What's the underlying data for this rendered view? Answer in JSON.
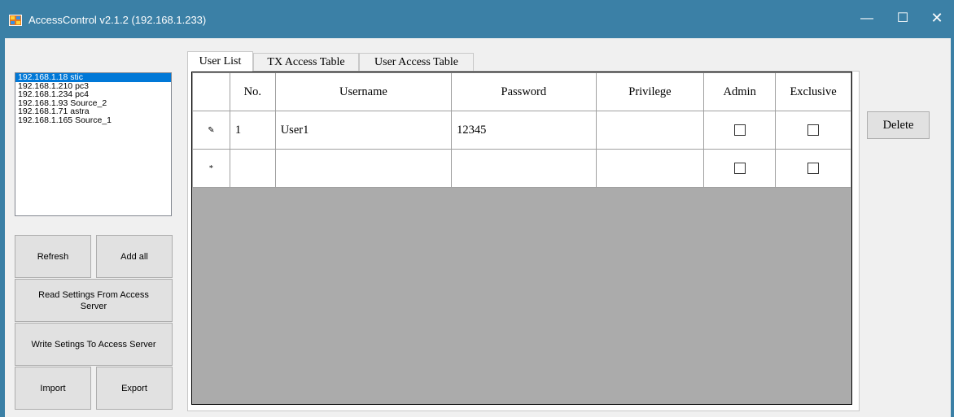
{
  "window": {
    "title": "AccessControl v2.1.2 (192.168.1.233)",
    "minimize_glyph": "—",
    "maximize_glyph": "☐",
    "close_glyph": "✕"
  },
  "hosts": [
    "192.168.1.18 stic",
    "192.168.1.210 pc3",
    "192.168.1.234 pc4",
    "192.168.1.93 Source_2",
    "192.168.1.71 astra",
    "192.168.1.165 Source_1"
  ],
  "buttons": {
    "refresh": "Refresh",
    "add_all": "Add all",
    "read_settings": "Read Settings From Access Server",
    "write_settings": "Write Setings To Access Server",
    "import": "Import",
    "export": "Export",
    "delete": "Delete"
  },
  "tabs": [
    "User List",
    "TX Access Table",
    "User Access Table"
  ],
  "grid": {
    "columns": [
      "No.",
      "Username",
      "Password",
      "Privilege",
      "Admin",
      "Exclusive"
    ],
    "rows": [
      {
        "marker": "✎",
        "no": "1",
        "username": "User1",
        "password": "12345",
        "privilege": "",
        "admin": false,
        "exclusive": false
      },
      {
        "marker": "*",
        "no": "",
        "username": "",
        "password": "",
        "privilege": "",
        "admin": false,
        "exclusive": false
      }
    ]
  },
  "colors": {
    "titlebar": "#3b80a6",
    "selection": "#0078d7",
    "grid_background": "#ababab"
  },
  "icons": {
    "app": "app-icon",
    "edit_row": "pencil-icon",
    "new_row": "asterisk-icon"
  }
}
